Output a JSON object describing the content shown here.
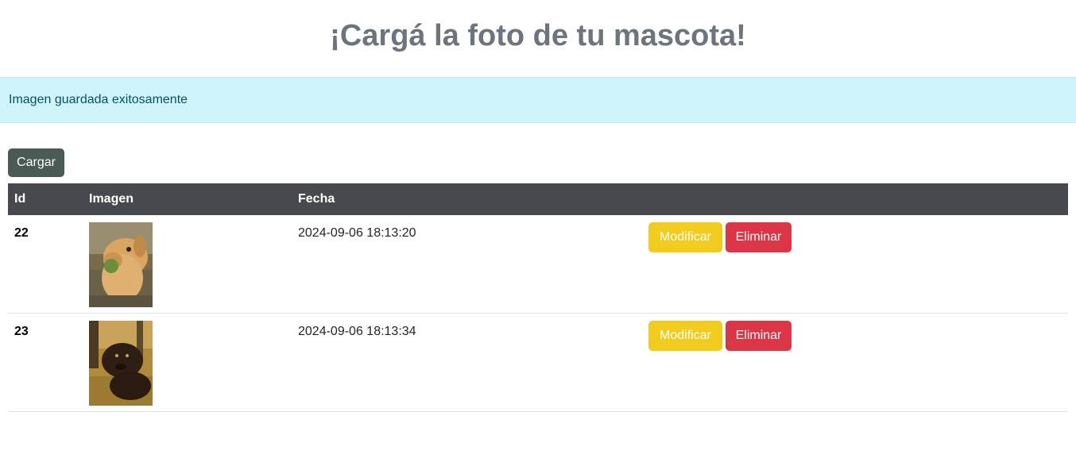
{
  "header": {
    "title": "¡Cargá la foto de tu mascota!"
  },
  "alert": {
    "message": "Imagen guardada exitosamente"
  },
  "toolbar": {
    "upload_label": "Cargar"
  },
  "table": {
    "columns": [
      "Id",
      "Imagen",
      "Fecha"
    ],
    "rows": [
      {
        "id": "22",
        "date": "2024-09-06 18:13:20",
        "edit_label": "Modificar",
        "delete_label": "Eliminar"
      },
      {
        "id": "23",
        "date": "2024-09-06 18:13:34",
        "edit_label": "Modificar",
        "delete_label": "Eliminar"
      }
    ]
  },
  "colors": {
    "alert_bg": "#cff4fc",
    "header_bg": "#48494e",
    "upload_button": "#4a5b55",
    "edit_button": "#f2cb1f",
    "delete_button": "#dc3545"
  }
}
